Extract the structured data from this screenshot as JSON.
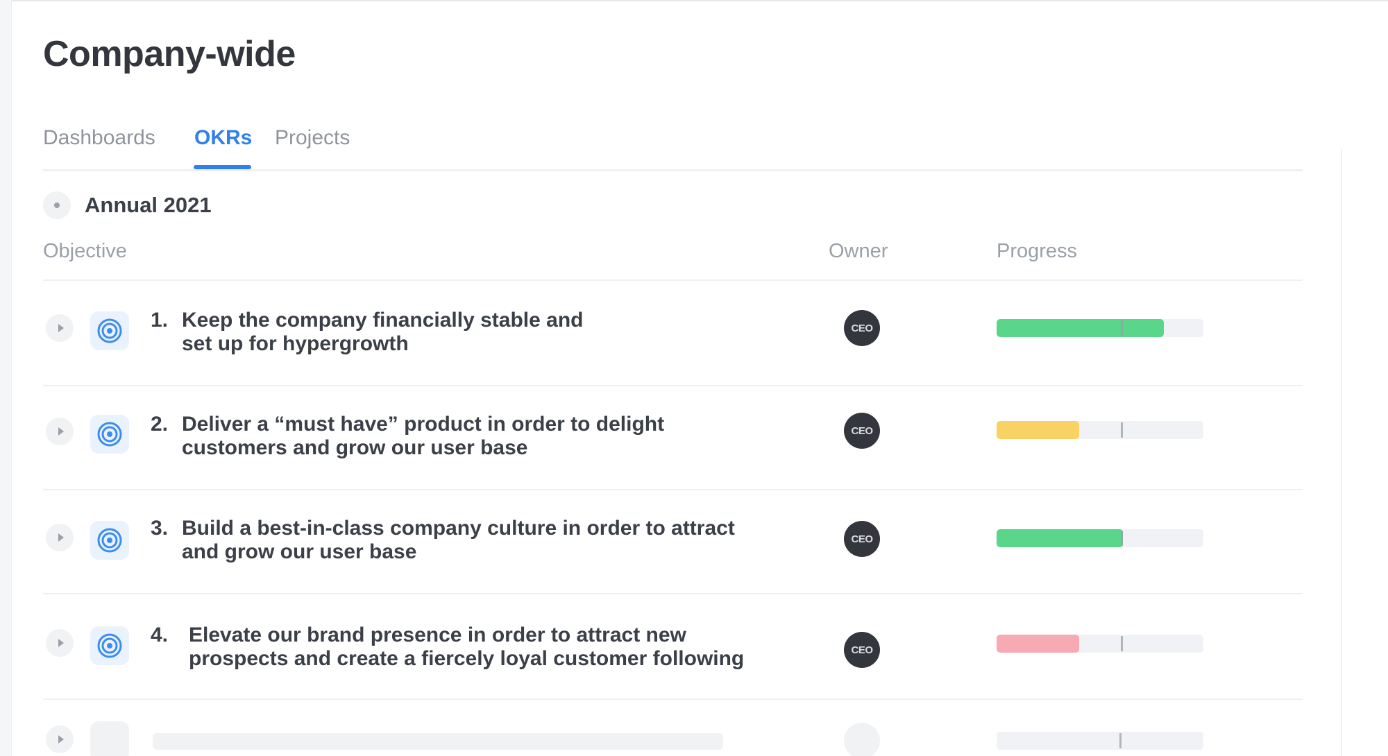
{
  "page": {
    "title": "Company-wide"
  },
  "tabs": [
    {
      "label": "Dashboards",
      "active": false
    },
    {
      "label": "OKRs",
      "active": true
    },
    {
      "label": "Projects",
      "active": false
    }
  ],
  "group": {
    "title": "Annual 2021"
  },
  "columns": {
    "objective": "Objective",
    "owner": "Owner",
    "progress": "Progress"
  },
  "objectives": [
    {
      "number": "1.",
      "line1": "Keep the company financially stable and",
      "line2": "set up for hypergrowth",
      "owner": "CEO",
      "progress": 0.81,
      "expected": 0.6,
      "status_color": "#5ad68a"
    },
    {
      "number": "2.",
      "line1": "Deliver a “must have” product in order to delight",
      "line2": "customers and grow our user base",
      "owner": "CEO",
      "progress": 0.4,
      "expected": 0.6,
      "status_color": "#f8d262"
    },
    {
      "number": "3.",
      "line1": "Build a best-in-class company culture in order to attract",
      "line2": "and grow our user base",
      "owner": "CEO",
      "progress": 0.61,
      "expected": 0.6,
      "status_color": "#5ad68a"
    },
    {
      "number": "4.",
      "line1": "Elevate our brand presence in order to attract new",
      "line2": "prospects and create a fiercely loyal customer following",
      "owner": "CEO",
      "progress": 0.4,
      "expected": 0.6,
      "status_color": "#f7a9b4"
    }
  ],
  "colors": {
    "accent": "#2f80ed",
    "icon_bg": "#eaf2fd",
    "avatar_bg": "#33363d",
    "track": "#f0f2f5"
  },
  "icons": {
    "objective": "target-icon",
    "expand": "caret-right-icon"
  }
}
